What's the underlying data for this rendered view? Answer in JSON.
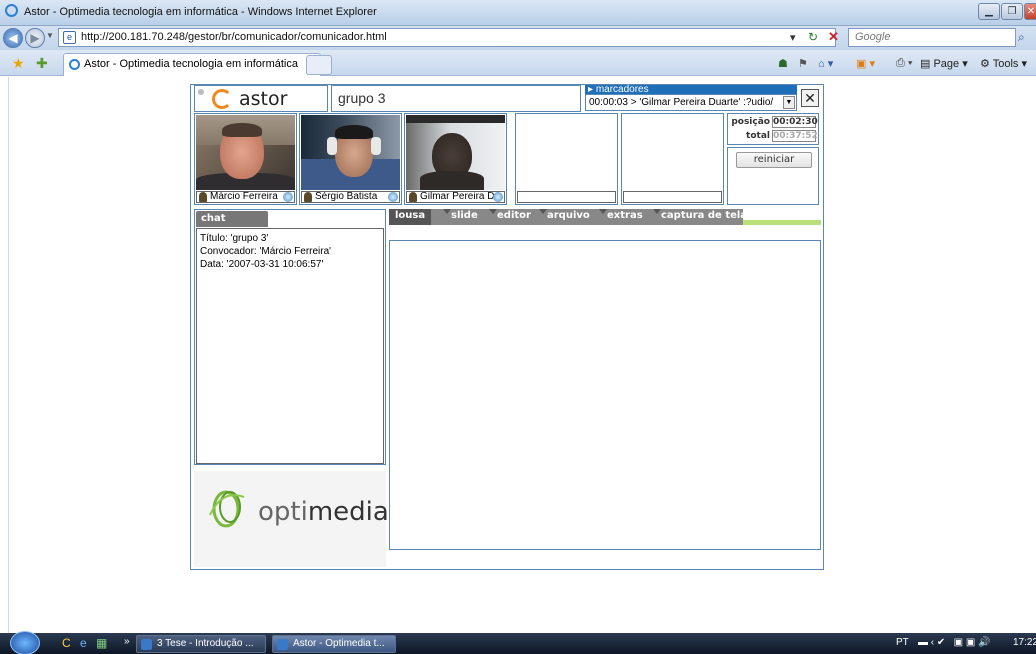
{
  "window": {
    "title": "Astor - Optimedia tecnologia em informática - Windows Internet Explorer"
  },
  "browser": {
    "url": "http://200.181.70.248/gestor/br/comunicador/comunicador.html",
    "search_placeholder": "Google",
    "tab_label": "Astor - Optimedia tecnologia em informática",
    "page_menu": "Page",
    "tools_menu": "Tools"
  },
  "app": {
    "logo_text": "astor",
    "group_name": "grupo 3",
    "markers": {
      "label": "marcadores",
      "selected": "00:00:03 >  'Gilmar Pereira Duarte' :?udio/"
    },
    "participants": [
      {
        "name": "Márcio Ferreira"
      },
      {
        "name": "Sérgio Batista"
      },
      {
        "name": "Gilmar Pereira D"
      }
    ],
    "position": {
      "pos_label": "posição",
      "pos_value": "00:02:30",
      "total_label": "total",
      "total_value": "00:37:52"
    },
    "restart_label": "reiniciar",
    "chat": {
      "tab_label": "chat público",
      "lines": [
        "Título: 'grupo 3'",
        "Convocador: 'Márcio Ferreira'",
        "Data: '2007-03-31 10:06:57'"
      ]
    },
    "brand": {
      "prefix": "opti",
      "suffix": "media"
    },
    "tabs": [
      {
        "label": "lousa",
        "active": true
      },
      {
        "label": "slide",
        "active": false
      },
      {
        "label": "editor",
        "active": false
      },
      {
        "label": "arquivo",
        "active": false
      },
      {
        "label": "extras",
        "active": false
      },
      {
        "label": "captura de tela",
        "active": false
      }
    ]
  },
  "taskbar": {
    "items": [
      {
        "label": "3 Tese - Introdução ..."
      },
      {
        "label": "Astor - Optimedia t..."
      }
    ],
    "language": "PT",
    "time": "17:22"
  },
  "colors": {
    "accent": "#1f6fb8",
    "orange": "#f08a1e",
    "green_bar": "#b9e07a"
  }
}
